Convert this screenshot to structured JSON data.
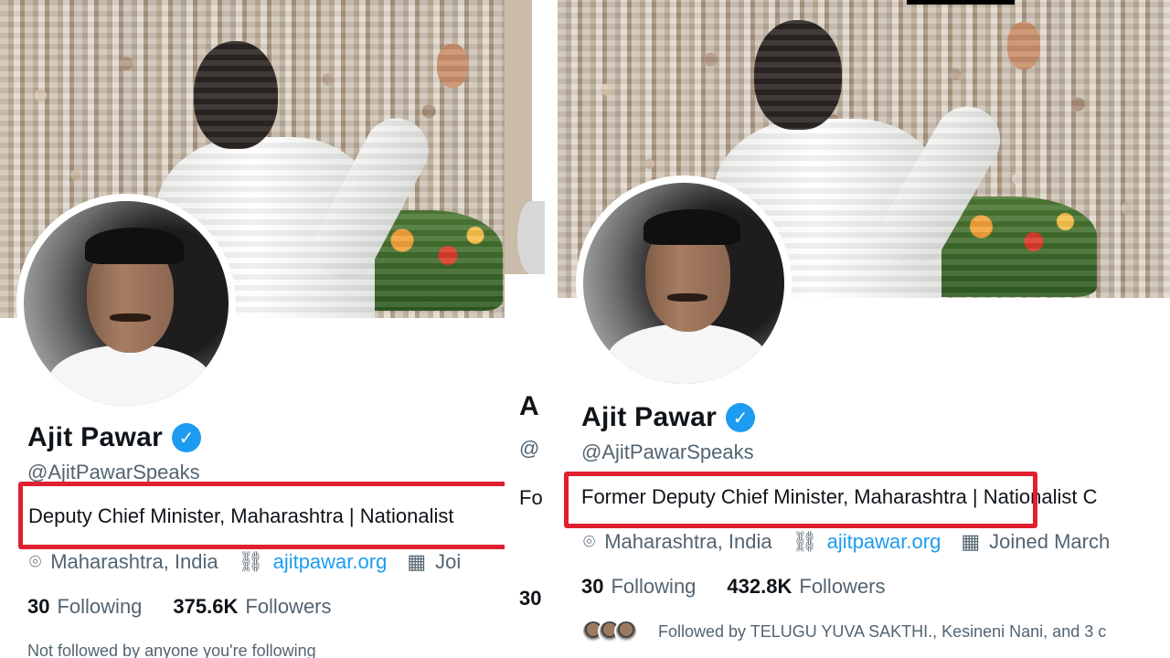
{
  "left_profile": {
    "name": "Ajit Pawar",
    "handle": "@AjitPawarSpeaks",
    "bio": "Deputy Chief Minister, Maharashtra | Nationalist",
    "location": "Maharashtra, India",
    "website": "ajitpawar.org",
    "joined": "Joi",
    "following_count": "30",
    "following_label": "Following",
    "followers_count": "375.6K",
    "followers_label": "Followers",
    "footnote": "Not followed by anyone you're following"
  },
  "right_profile": {
    "name": "Ajit Pawar",
    "handle": "@AjitPawarSpeaks",
    "bio": "Former Deputy Chief Minister, Maharashtra | Nationalist C",
    "location": "Maharashtra, India",
    "website": "ajitpawar.org",
    "joined": "Joined March",
    "following_count": "30",
    "following_label": "Following",
    "followers_count": "432.8K",
    "followers_label": "Followers",
    "followed_by": "Followed by TELUGU YUVA SAKTHI., Kesineni Nani, and 3 c"
  },
  "middle_strip": {
    "letter_a": "A",
    "letter_at": "@",
    "letter_fo": "Fo",
    "letter_30": "30"
  },
  "icons": {
    "verified": "verified-badge-icon",
    "location": "location-pin-icon",
    "link": "link-icon",
    "calendar": "calendar-icon"
  },
  "colors": {
    "highlight_box": "#e0202f",
    "verified_blue": "#1d9bf0",
    "link_blue": "#1d9bf0"
  }
}
